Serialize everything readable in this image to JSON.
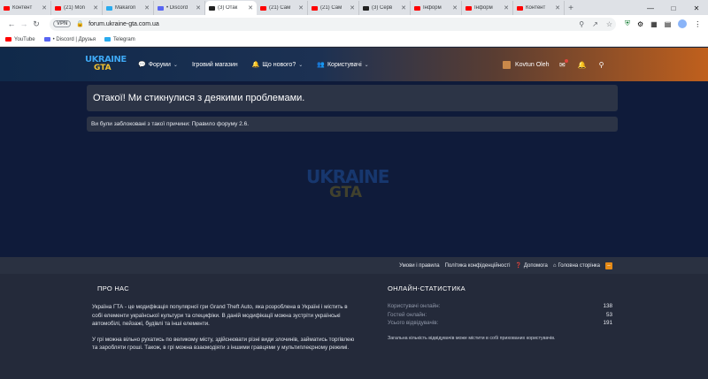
{
  "browser": {
    "tabs": [
      {
        "label": "Контент",
        "color": "#ff0000",
        "active": false
      },
      {
        "label": "(21) Mon",
        "color": "#ff0000",
        "active": false
      },
      {
        "label": "Makaron",
        "color": "#2aabee",
        "active": false
      },
      {
        "label": "• Discord",
        "color": "#5865f2",
        "active": false
      },
      {
        "label": "(3) Отак",
        "color": "#222222",
        "active": true
      },
      {
        "label": "(21) Сам",
        "color": "#ff0000",
        "active": false
      },
      {
        "label": "(21) Сам",
        "color": "#ff0000",
        "active": false
      },
      {
        "label": "(3) Серв",
        "color": "#222222",
        "active": false
      },
      {
        "label": "Інформ",
        "color": "#ff0000",
        "active": false
      },
      {
        "label": "Інформ",
        "color": "#ff0000",
        "active": false
      },
      {
        "label": "Контент",
        "color": "#ff0000",
        "active": false
      }
    ],
    "new_tab": "+",
    "url": "forum.ukraine-gta.com.ua",
    "vpn_label": "VPN",
    "bookmarks": [
      {
        "label": "YouTube",
        "color": "#ff0000"
      },
      {
        "label": "• Discord | Друзья",
        "color": "#5865f2"
      },
      {
        "label": "Telegram",
        "color": "#2aabee"
      }
    ]
  },
  "site": {
    "logo": {
      "line1": "UKRAINE",
      "line2": "GTA"
    },
    "nav": [
      {
        "label": "Форуми",
        "icon": "chat-icon",
        "glyph": "💬",
        "dropdown": true
      },
      {
        "label": "Ігровий магазин",
        "icon": "",
        "glyph": "",
        "dropdown": false
      },
      {
        "label": "Що нового?",
        "icon": "bell-icon",
        "glyph": "🔔",
        "dropdown": true
      },
      {
        "label": "Користувачі",
        "icon": "users-icon",
        "glyph": "👥",
        "dropdown": true
      }
    ],
    "user": {
      "name": "Kovtun Oleh"
    },
    "header_icons": [
      "inbox-icon",
      "alerts-icon",
      "search-icon"
    ]
  },
  "error": {
    "title": "Отакої! Ми стикнулися з деякими проблемами.",
    "message": "Ви були заблоковані з такої причини: Правило форуму 2.6."
  },
  "footer_links": [
    {
      "label": "Умови і правила",
      "icon": ""
    },
    {
      "label": "Політика конфіденційності",
      "icon": ""
    },
    {
      "label": "Допомога",
      "icon": "help-icon"
    },
    {
      "label": "Головна сторінка",
      "icon": "home-icon"
    }
  ],
  "about": {
    "title": "ПРО НАС",
    "paragraphs": [
      "Україна ГТА - це модифікація популярної гри Grand Theft Auto, яка розроблена в Україні і містить в собі елементи української культури та специфіки. В даній модифікації можна зустріти українські автомобілі, пейзажі, будівлі та інші елементи.",
      "У грі можна вільно рухатись по великому місту, здійснювати різні види злочинів, займатись торгівлею та заробляти гроші. Також, в грі можна взаємодіяти з іншими гравцями у мультиплеєрному режимі."
    ]
  },
  "stats": {
    "title": "ОНЛАЙН-СТАТИСТИКА",
    "rows": [
      {
        "label": "Користувачі онлайн:",
        "value": "138"
      },
      {
        "label": "Гостей онлайн:",
        "value": "53"
      },
      {
        "label": "Усього відвідувачів:",
        "value": "191"
      }
    ],
    "note": "Загальна кількість відвідувачів може містити в собі прихованих користувачів."
  }
}
